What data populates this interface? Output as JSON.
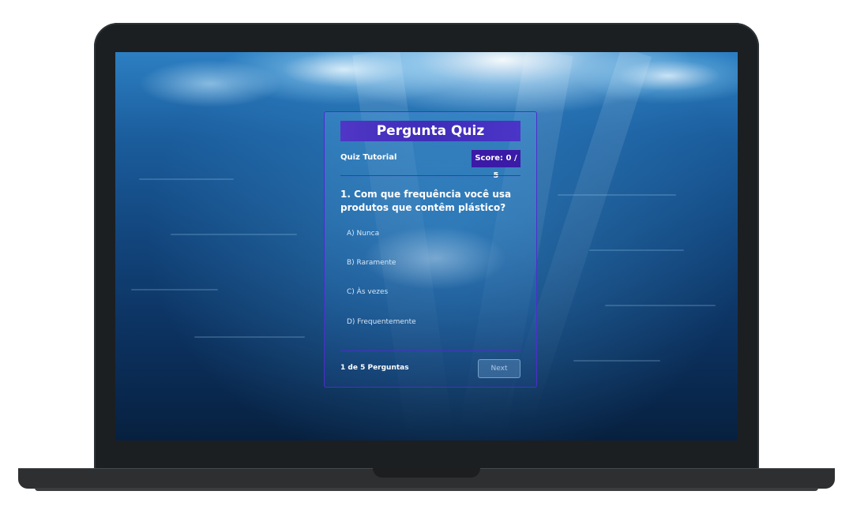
{
  "quiz": {
    "title": "Pergunta Quiz",
    "name": "Quiz Tutorial",
    "score": "Score: 0 / 5",
    "question": "1. Com que frequência você usa produtos que contêm plástico?",
    "options": [
      "A) Nunca",
      "B) Raramente",
      "C) Às vezes",
      "D) Frequentemente"
    ],
    "progress": "1 de 5 Perguntas",
    "next_label": "Next"
  },
  "colors": {
    "accent": "#3f2db8",
    "score_badge": "#3a1aa6",
    "border": "#4f2ccf"
  }
}
